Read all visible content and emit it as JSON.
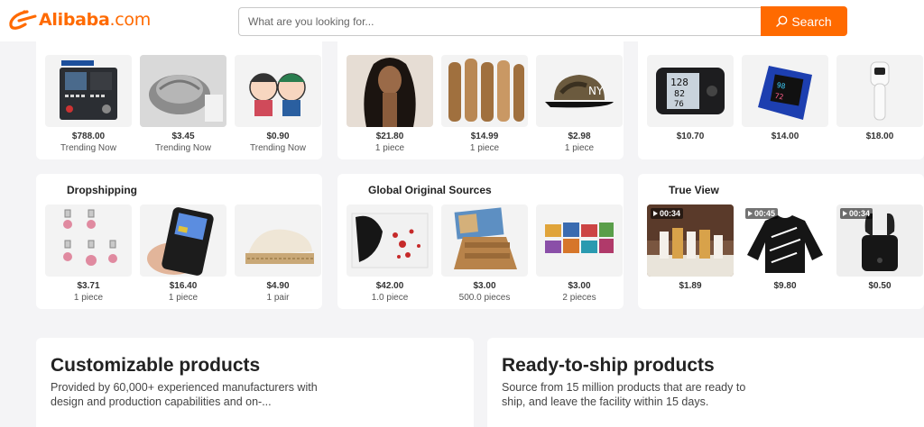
{
  "header": {
    "logo_text": "Alibaba.com",
    "search_placeholder": "What are you looking for...",
    "search_button": "Search"
  },
  "colors": {
    "brand": "#ff6a00",
    "background": "#f4f4f6",
    "card": "#ffffff"
  },
  "top_row": [
    {
      "products": [
        {
          "price": "$788.00",
          "sub": "Trending Now"
        },
        {
          "price": "$3.45",
          "sub": "Trending Now"
        },
        {
          "price": "$0.90",
          "sub": "Trending Now"
        }
      ]
    },
    {
      "products": [
        {
          "price": "$21.80",
          "sub": "1 piece"
        },
        {
          "price": "$14.99",
          "sub": "1 piece"
        },
        {
          "price": "$2.98",
          "sub": "1 piece"
        }
      ]
    },
    {
      "products": [
        {
          "price": "$10.70",
          "sub": ""
        },
        {
          "price": "$14.00",
          "sub": ""
        },
        {
          "price": "$18.00",
          "sub": ""
        }
      ]
    }
  ],
  "second_row": [
    {
      "title": "Dropshipping",
      "products": [
        {
          "price": "$3.71",
          "sub": "1 piece"
        },
        {
          "price": "$16.40",
          "sub": "1 piece"
        },
        {
          "price": "$4.90",
          "sub": "1 pair"
        }
      ]
    },
    {
      "title": "Global Original Sources",
      "products": [
        {
          "price": "$42.00",
          "sub": "1.0 piece"
        },
        {
          "price": "$3.00",
          "sub": "500.0 pieces"
        },
        {
          "price": "$3.00",
          "sub": "2 pieces"
        }
      ]
    },
    {
      "title": "True View",
      "products": [
        {
          "price": "$1.89",
          "sub": "",
          "video": "00:34"
        },
        {
          "price": "$9.80",
          "sub": "",
          "video": "00:45"
        },
        {
          "price": "$0.50",
          "sub": "",
          "video": "00:34"
        }
      ]
    }
  ],
  "bottom": [
    {
      "title": "Customizable products",
      "desc": "Provided by 60,000+ experienced manufacturers with design and production capabilities and on-..."
    },
    {
      "title": "Ready-to-ship products",
      "desc": "Source from 15 million products that are ready to ship, and leave the facility within 15 days."
    }
  ]
}
